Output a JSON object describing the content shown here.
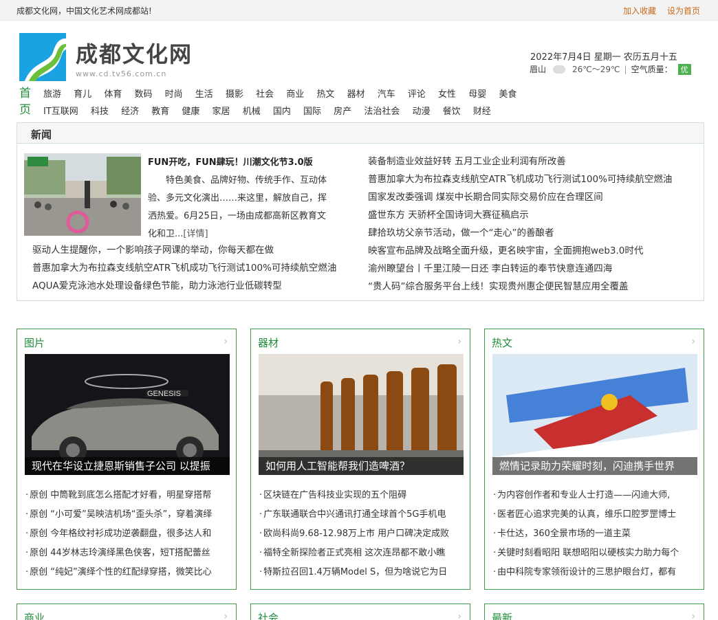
{
  "topbar": {
    "slogan": "成都文化网，中国文化艺术网成都站!",
    "favorite": "加入收藏",
    "homepage": "设为首页"
  },
  "logo": {
    "title": "成都文化网",
    "url": "www.cd.tv56.com.cn"
  },
  "date": {
    "text": "2022年7月4日 星期一 农历五月十五"
  },
  "weather": {
    "city": "眉山",
    "temp": "26℃～29℃",
    "sep": "|",
    "aqi_label": "空气质量：",
    "aqi_value": "优"
  },
  "nav": {
    "home": "首页",
    "row1": [
      "旅游",
      "育儿",
      "体育",
      "数码",
      "时尚",
      "生活",
      "摄影",
      "社会",
      "商业",
      "热文",
      "器材",
      "汽车",
      "评论",
      "女性",
      "母婴",
      "美食"
    ],
    "row2": [
      "IT互联网",
      "科技",
      "经济",
      "教育",
      "健康",
      "家居",
      "机械",
      "国内",
      "国际",
      "房产",
      "法治社会",
      "动漫",
      "餐饮",
      "财经"
    ]
  },
  "news": {
    "title": "新闻",
    "lead_title": "FUN开吃，FUN肆玩！川潮文化节3.0版",
    "lead_text": "特色美食、品牌好物、传统手作、互动体验、多元文化演出……来这里，解放自己，挥洒热爱。6月25日，一场由成都高新区教育文化和卫...",
    "lead_more": "[详情]",
    "left_list": [
      "驱动人生提醒你，一个影响孩子网课的举动，你每天都在做",
      "普惠加拿大为布拉森支线航空ATR飞机成功飞行测试100%可持续航空燃油",
      "AQUA爱克泳池水处理设备绿色节能，助力泳池行业低碳转型"
    ],
    "right_list": [
      "装备制造业效益好转 五月工业企业利润有所改善",
      "普惠加拿大为布拉森支线航空ATR飞机成功飞行测试100%可持续航空燃油",
      "国家发改委强调 煤炭中长期合同实际交易价应在合理区间",
      "盛世东方 天骄杯全国诗词大赛征稿启示",
      "肆拾玖坊父亲节活动，做一个“走心”的善酿者",
      "映客宣布品牌及战略全面升级，更名映宇宙，全面拥抱web3.0时代",
      "渝州瞭望台丨千里江陵一日还 李白转运的奉节快意连通四海",
      "“贵人码”综合服务平台上线！实现贵州惠企便民智慧应用全覆盖"
    ]
  },
  "cards": [
    {
      "title": "图片",
      "caption": "现代在华设立捷恩斯销售子公司 以提振",
      "items": [
        "原创 中筒靴到底怎么搭配才好看，明星穿搭帮",
        "原创 “小可爱”吴映洁机场“歪头杀”，穿着演绎",
        "原创 今年格纹衬衫成功逆袭翻盘，很多达人和",
        "原创 44岁林志玲演绎黑色侠客，短T搭配蕾丝",
        "原创 “纯妃”演绎个性的红配绿穿搭，微笑比心"
      ]
    },
    {
      "title": "器材",
      "caption": "如何用人工智能帮我们造啤酒？",
      "items": [
        "区块链在广告科技业实现的五个阻碍",
        "广东联通联合中兴通讯打通全球首个5G手机电",
        "欧尚科尚9.68-12.98万上市 用户口碑决定成败",
        "福特全新探险者正式亮相 这次连昂都不敢小瞧",
        "特斯拉召回1.4万辆Model S，但为啥说它为日"
      ]
    },
    {
      "title": "热文",
      "caption": "燃情记录助力荣耀时刻，闪迪携手世界",
      "items": [
        "为内容创作者和专业人士打造——闪迪大师,",
        "医者匠心追求完美的认真，维乐口腔罗罡博士",
        "卡仕达，360全景市场的一道主菜",
        "关键时刻看昭阳 联想昭阳以硬核实力助力每个",
        "由中科院专家领衔设计的三思护眼台灯，都有"
      ]
    }
  ],
  "bottom_cards": [
    "商业",
    "社会",
    "最新"
  ],
  "arrow": "›"
}
